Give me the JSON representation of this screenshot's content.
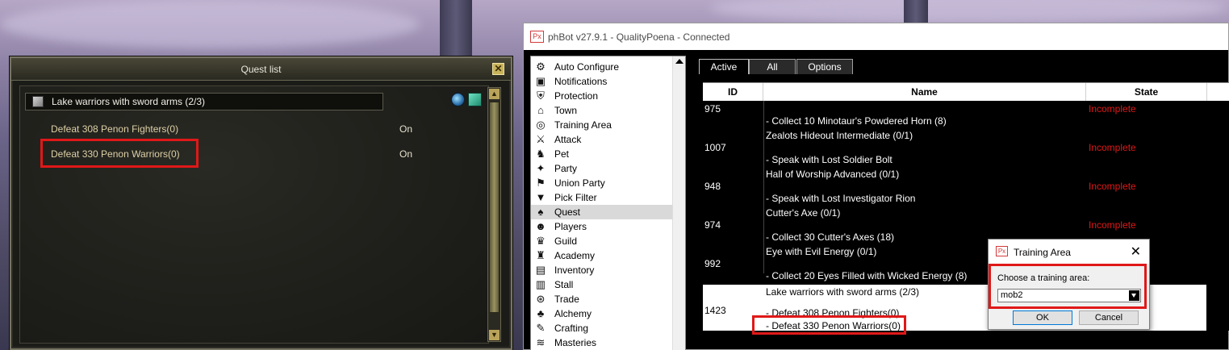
{
  "quest_list": {
    "title": "Quest list",
    "close_symbol": "✕",
    "header_quest": "Lake warriors with sword arms (2/3)",
    "objectives": [
      {
        "name": "Defeat 308 Penon Fighters(0)",
        "state": "On"
      },
      {
        "name": "Defeat 330 Penon Warriors(0)",
        "state": "On"
      }
    ]
  },
  "phbot": {
    "logo": "Px",
    "title": "phBot v27.9.1 - QualityPoena - Connected",
    "nav_items": [
      {
        "label": "Auto Configure",
        "icon": "gear-icon"
      },
      {
        "label": "Notifications",
        "icon": "bell-icon"
      },
      {
        "label": "Protection",
        "icon": "shield-icon"
      },
      {
        "label": "Town",
        "icon": "town-icon"
      },
      {
        "label": "Training Area",
        "icon": "target-icon"
      },
      {
        "label": "Attack",
        "icon": "sword-icon"
      },
      {
        "label": "Pet",
        "icon": "pet-icon"
      },
      {
        "label": "Party",
        "icon": "party-icon"
      },
      {
        "label": "Union Party",
        "icon": "union-icon"
      },
      {
        "label": "Pick Filter",
        "icon": "filter-icon"
      },
      {
        "label": "Quest",
        "icon": "quest-icon",
        "active": true
      },
      {
        "label": "Players",
        "icon": "players-icon"
      },
      {
        "label": "Guild",
        "icon": "guild-icon"
      },
      {
        "label": "Academy",
        "icon": "academy-icon"
      },
      {
        "label": "Inventory",
        "icon": "inventory-icon"
      },
      {
        "label": "Stall",
        "icon": "stall-icon"
      },
      {
        "label": "Trade",
        "icon": "trade-icon"
      },
      {
        "label": "Alchemy",
        "icon": "alchemy-icon"
      },
      {
        "label": "Crafting",
        "icon": "crafting-icon"
      },
      {
        "label": "Masteries",
        "icon": "masteries-icon"
      }
    ],
    "tabs": [
      "Active",
      "All",
      "Options"
    ],
    "columns": [
      "ID",
      "Name",
      "State"
    ],
    "rows": [
      {
        "id": "975",
        "state": "Incomplete",
        "lines": [
          "- Collect 10 Minotaur's Powdered Horn (8)",
          "Zealots Hideout Intermediate (0/1)"
        ]
      },
      {
        "id": "1007",
        "state": "Incomplete",
        "lines": [
          "- Speak with Lost Soldier Bolt",
          "Hall of Worship Advanced (0/1)"
        ]
      },
      {
        "id": "948",
        "state": "Incomplete",
        "lines": [
          "- Speak with Lost Investigator Rion",
          "Cutter's Axe (0/1)"
        ]
      },
      {
        "id": "974",
        "state": "Incomplete",
        "lines": [
          "- Collect 30 Cutter's Axes (18)",
          "Eye with Evil Energy (0/1)"
        ]
      },
      {
        "id": "992",
        "state": "",
        "lines": [
          "- Collect 20 Eyes Filled with Wicked Energy (8)"
        ]
      },
      {
        "id": "1423",
        "state": "",
        "lines": [
          "Lake warriors with sword arms (2/3)",
          "- Defeat 308 Penon Fighters(0)",
          "- Defeat 330 Penon Warriors(0)"
        ]
      }
    ]
  },
  "dialog": {
    "logo": "Px",
    "title": "Training Area",
    "close_symbol": "✕",
    "label": "Choose a training area:",
    "selected": "mob2",
    "ok": "OK",
    "cancel": "Cancel"
  },
  "colors": {
    "highlight": "#e01818",
    "incomplete": "#e01818"
  }
}
